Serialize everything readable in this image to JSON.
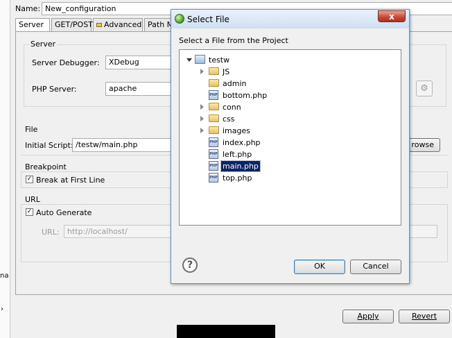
{
  "name_row": {
    "label": "Name:",
    "value": "New_configuration"
  },
  "tabs": [
    {
      "label": "Server",
      "active": true
    },
    {
      "label": "GET/POST"
    },
    {
      "label": "Advanced",
      "icon": "lock-icon"
    },
    {
      "label": "Path M"
    }
  ],
  "server_group": {
    "title": "Server",
    "debugger_label": "Server Debugger:",
    "debugger_value": "XDebug",
    "php_server_label": "PHP Server:",
    "php_server_value": "apache"
  },
  "file_group": {
    "title": "File",
    "initial_script_label": "Initial Script:",
    "initial_script_value": "/testw/main.php",
    "browse_label": "rowse"
  },
  "breakpoint_group": {
    "title": "Breakpoint",
    "break_first_line_label": "Break at First Line",
    "break_first_line_checked": "✓"
  },
  "url_group": {
    "title": "URL",
    "auto_generate_label": "Auto Generate",
    "auto_generate_checked": "✓",
    "url_label": "URL:",
    "url_value": "http://localhost/"
  },
  "left_strip": {
    "text": "na"
  },
  "footer": {
    "apply_label": "Apply",
    "revert_label": "Revert"
  },
  "dialog": {
    "title": "Select File",
    "close_glyph": "x",
    "prompt": "Select a File from the Project",
    "tree": [
      {
        "label": "testw",
        "type": "project",
        "level": 0,
        "expanded": true
      },
      {
        "label": "JS",
        "type": "folder",
        "level": 1,
        "collapsed": true
      },
      {
        "label": "admin",
        "type": "folder",
        "level": 1
      },
      {
        "label": "bottom.php",
        "type": "php",
        "level": 1
      },
      {
        "label": "conn",
        "type": "folder",
        "level": 1,
        "collapsed": true
      },
      {
        "label": "css",
        "type": "folder",
        "level": 1,
        "collapsed": true
      },
      {
        "label": "images",
        "type": "folder",
        "level": 1,
        "collapsed": true
      },
      {
        "label": "index.php",
        "type": "php",
        "level": 1
      },
      {
        "label": "left.php",
        "type": "php",
        "level": 1
      },
      {
        "label": "main.php",
        "type": "php",
        "level": 1,
        "selected": true
      },
      {
        "label": "top.php",
        "type": "php",
        "level": 1
      }
    ],
    "ok_label": "OK",
    "cancel_label": "Cancel",
    "help_glyph": "?",
    "php_icon_text": "PHP"
  }
}
